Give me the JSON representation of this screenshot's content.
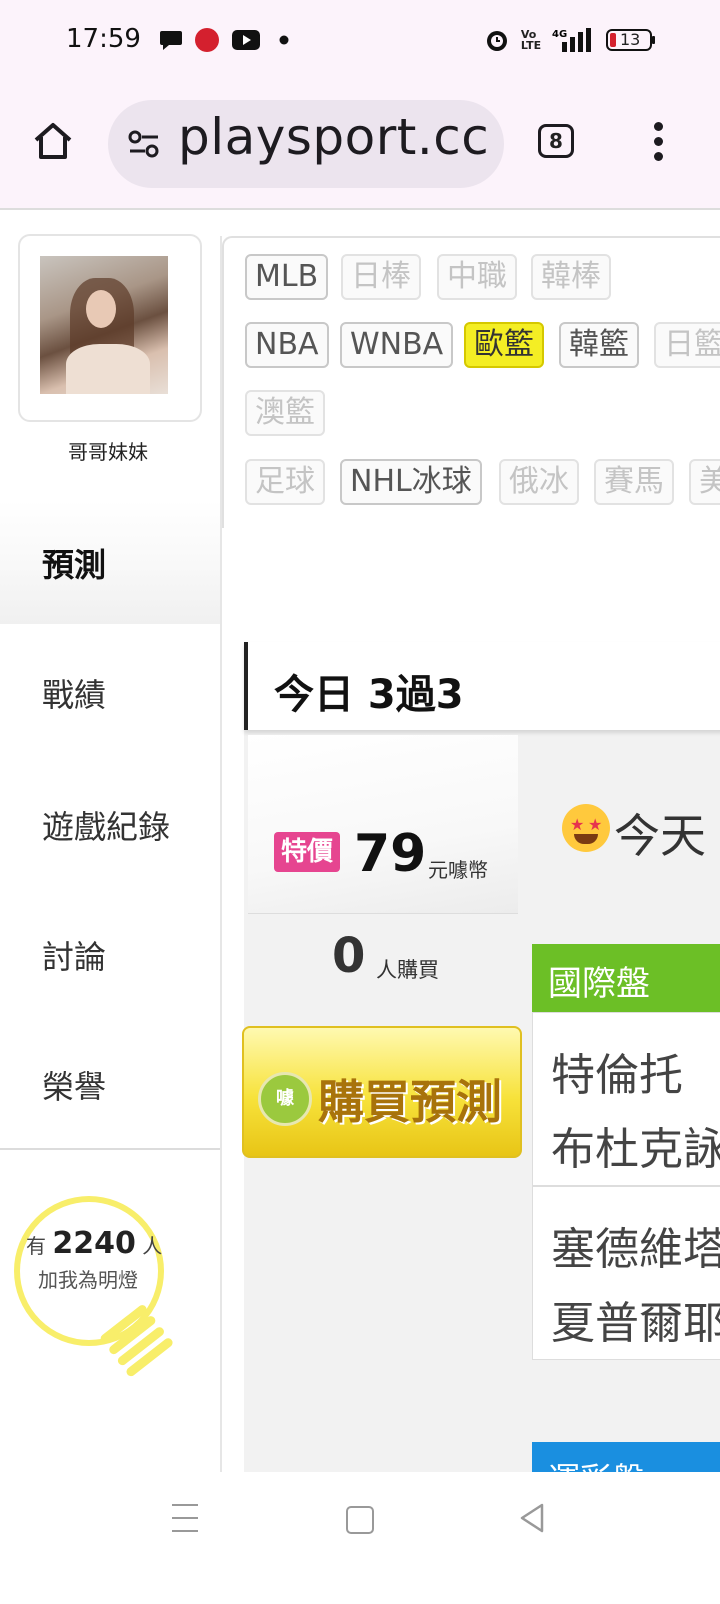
{
  "status_bar": {
    "time": "17:59",
    "battery": "13"
  },
  "browser": {
    "url": "playsport.cc",
    "tab_count": "8"
  },
  "profile": {
    "username": "哥哥妹妹"
  },
  "nav": {
    "prediction": "預測",
    "items": [
      "戰績",
      "遊戲紀錄",
      "討論",
      "榮譽"
    ]
  },
  "fans": {
    "prefix": "有",
    "count": "2240",
    "suffix": "人",
    "label": "加我為明燈"
  },
  "tags": {
    "row1": [
      "MLB",
      "日棒",
      "中職",
      "韓棒"
    ],
    "row2": [
      "NBA",
      "WNBA",
      "歐籃",
      "韓籃",
      "日籃"
    ],
    "row3": [
      "澳籃"
    ],
    "row4": [
      "足球",
      "NHL冰球",
      "俄冰",
      "賽馬",
      "美"
    ],
    "active": "歐籃"
  },
  "main": {
    "record_title": "今日 3過3",
    "special_badge": "特價",
    "price": "79",
    "price_unit": "元噱幣",
    "buyers_count": "0",
    "buyers_label": "人購買",
    "buy_button": "購買預測",
    "buy_coin": "噱",
    "promo": "今天",
    "intl_header": "國際盤",
    "matches": [
      {
        "home": "特倫托",
        "away": "布杜克詠"
      },
      {
        "home": "塞德維塔",
        "away": "夏普爾耶"
      }
    ],
    "lottery_header": "運彩盤"
  },
  "colors": {
    "active_tag": "#f4ee24",
    "special_badge": "#e64590",
    "intl_header": "#6cbf26",
    "lottery_header": "#1a8fe0",
    "bulb": "#f8ee6a"
  }
}
